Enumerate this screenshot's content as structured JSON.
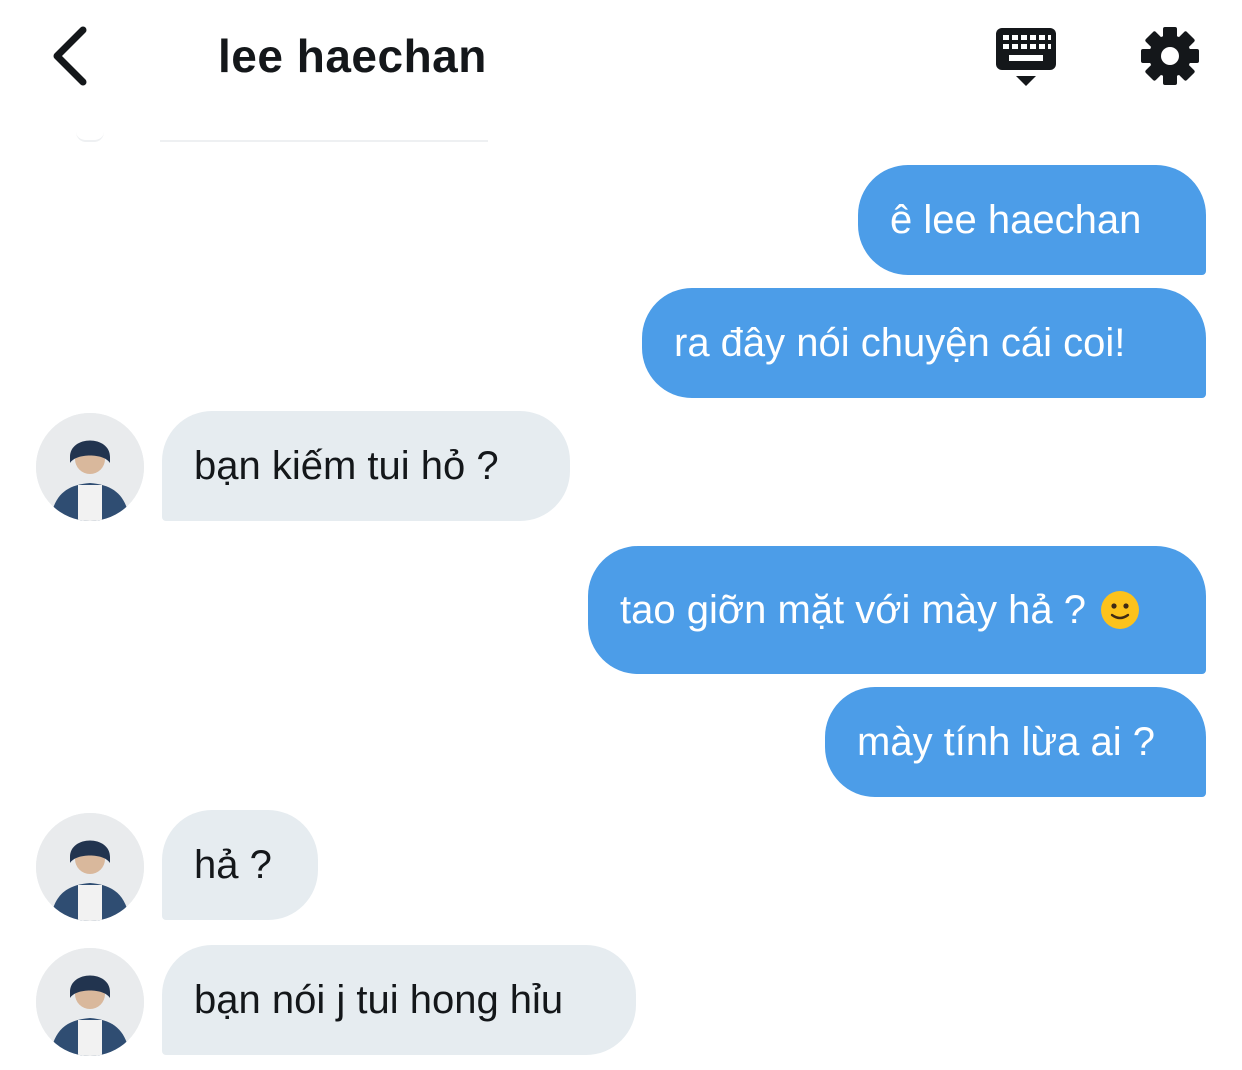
{
  "header": {
    "title": "lee haechan",
    "back_icon": "chevron-left-icon",
    "keyboard_icon": "keyboard-icon",
    "settings_icon": "gear-icon"
  },
  "colors": {
    "sent_bubble": "#4c9de8",
    "received_bubble": "#e6ecf0",
    "text_dark": "#14171a",
    "background": "#ffffff"
  },
  "messages": [
    {
      "direction": "sent",
      "text": "ê lee haechan"
    },
    {
      "direction": "sent",
      "text": "ra đây nói chuyện cái coi!"
    },
    {
      "direction": "received",
      "text": "bạn kiếm tui hỏ ?"
    },
    {
      "direction": "sent",
      "text": "tao giỡn mặt với mày hả ?",
      "emoji": "slightly-smiling-face-emoji"
    },
    {
      "direction": "sent",
      "text": "mày tính lừa ai ?"
    },
    {
      "direction": "received",
      "text": "hả ?"
    },
    {
      "direction": "received",
      "text": "bạn nói j tui hong hỉu"
    }
  ]
}
